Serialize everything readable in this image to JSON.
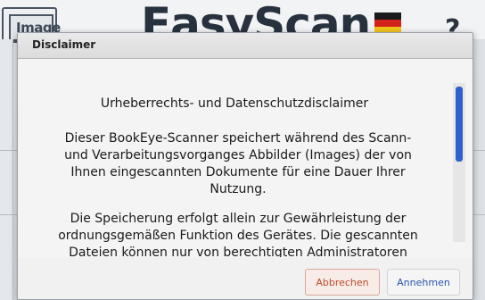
{
  "background_app": {
    "logo_text": "Image",
    "brand_text": "EasyScan",
    "help_glyph": "?",
    "flag_colors": [
      "#1a1a1a",
      "#d3211c",
      "#f0c419"
    ]
  },
  "dialog": {
    "title": "Disclaimer",
    "heading": "Urheberrechts- und Datenschutzdisclaimer",
    "paragraph1_lines": [
      "Dieser BookEye-Scanner speichert während des Scann-",
      "und Verarbeitungsvorganges Abbilder (Images) der von",
      "Ihnen eingescannten Dokumente für eine Dauer Ihrer",
      "Nutzung."
    ],
    "paragraph2_lines": [
      "Die Speicherung erfolgt allein zur Gewährleistung der",
      "ordnungsgemäßen Funktion des Gerätes. Die gescannten",
      "Dateien können nur von berechtigten Administratoren"
    ],
    "buttons": {
      "cancel_label": "Abbrechen",
      "accept_label": "Annehmen"
    },
    "colors": {
      "scroll_thumb": "#3060c8",
      "cancel_text": "#c04a2a",
      "accept_text": "#2b55a8"
    }
  }
}
